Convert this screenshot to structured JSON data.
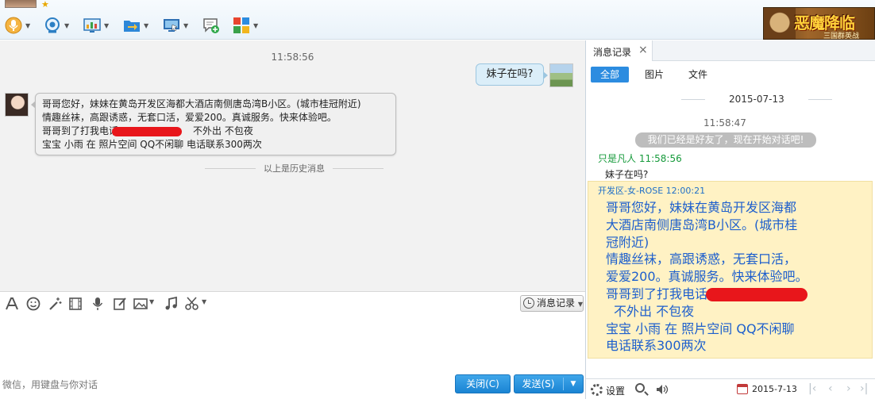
{
  "toolbar": {
    "items": [
      "voice-call",
      "video-call",
      "share-screen",
      "send-file",
      "remote-desktop",
      "create-discussion",
      "app-center"
    ],
    "accent": "#2c8ce0"
  },
  "banner": {
    "title": "恶魔降临",
    "subtitle": "三国群英战"
  },
  "chat": {
    "time": "11:58:56",
    "my_message": "妹子在吗?",
    "her_lines": [
      "哥哥您好，妹妹在黄岛开发区海都大酒店南侧唐岛湾B小区。(城市桂冠附近)",
      "情趣丝袜，高跟诱惑，无套口活，爱爱200。真诚服务。快来体验吧。",
      "哥哥到了打我电话",
      "不外出 不包夜",
      "宝宝 小雨 在 照片空间 QQ不闲聊 电话联系300两次"
    ],
    "history_divider": "以上是历史消息"
  },
  "editor": {
    "history_button": "消息记录",
    "hint": "微信，用键盘与你对话",
    "close_button": "关闭(C)",
    "send_button": "发送(S)"
  },
  "history_panel": {
    "tab_label": "消息记录",
    "filters": [
      "全部",
      "图片",
      "文件"
    ],
    "date": "2015-07-13",
    "time": "11:58:47",
    "system_message": "我们已经是好友了，现在开始对话吧!",
    "my_header": "只是凡人 11:58:56",
    "my_message": "妹子在吗?",
    "her_header": "开发区-女-ROSE 12:00:21",
    "her_lines": [
      "哥哥您好，妹妹在黄岛开发区海都",
      "大酒店南侧唐岛湾B小区。(城市桂",
      "冠附近)",
      "情趣丝袜，高跟诱惑，无套口活，",
      "爱爱200。真诚服务。快来体验吧。",
      "哥哥到了打我电话",
      "不外出 不包夜",
      "宝宝 小雨 在 照片空间 QQ不闲聊",
      "电话联系300两次"
    ],
    "settings_label": "设置",
    "bottom_date": "2015-7-13"
  },
  "colors": {
    "her_block_bg": "#fff2c4",
    "her_text": "#1d5fcd",
    "redaction": "#e8161b",
    "my_name": "#169a3b"
  }
}
